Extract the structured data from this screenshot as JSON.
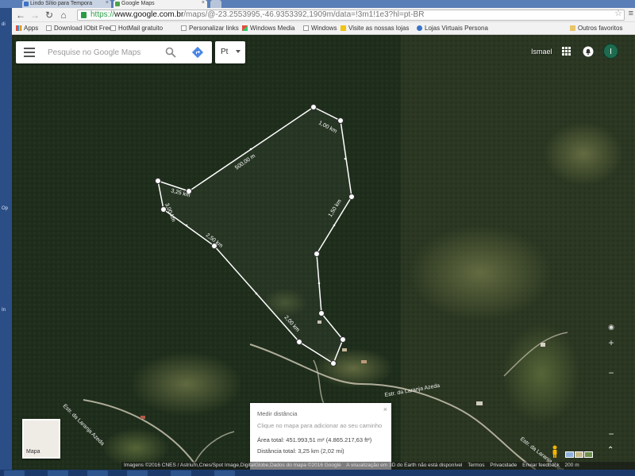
{
  "browser": {
    "tabs": [
      {
        "title": "Lindo Sítio para Tempora",
        "active": false
      },
      {
        "title": "Google Maps",
        "active": true
      }
    ],
    "url": {
      "scheme": "https://",
      "host": "www.google.com.br",
      "path": "/maps/@-23.2553995,-46.9353392,1909m/data=!3m1!1e3?hl=pt-BR"
    },
    "bookmarks": [
      {
        "label": "Apps",
        "icon": "apps-grid-icon"
      },
      {
        "label": "Download IObit Free",
        "icon": "page-icon"
      },
      {
        "label": "HotMail gratuito",
        "icon": "page-icon"
      },
      {
        "label": "Personalizar links",
        "icon": "page-icon"
      },
      {
        "label": "Windows Media",
        "icon": "windows-icon"
      },
      {
        "label": "Windows",
        "icon": "page-icon"
      },
      {
        "label": "Visite as nossas lojas",
        "icon": "store-icon"
      },
      {
        "label": "Lojas Virtuais Persona",
        "icon": "store-icon"
      }
    ],
    "other_bookmarks": "Outros favoritos"
  },
  "maps": {
    "search_placeholder": "Pesquise no Google Maps",
    "language": "Pt",
    "username": "Ismael",
    "avatar_letter": "I",
    "map_type_label": "Mapa",
    "measure": {
      "title": "Medir distância",
      "hint": "Clique no mapa para adicionar ao seu caminho",
      "area": "Área total: 451.993,51 m² (4.865.217,63 ft²)",
      "distance": "Distância total: 3,25 km (2,02 mi)"
    },
    "segment_labels": [
      "500,00 m",
      "1,00 km",
      "1,50 km",
      "2,00 km",
      "2,50 km",
      "3,00 km",
      "3,25 km"
    ],
    "road_labels": [
      "Estr. da Laranja Azeda",
      "Estr. da Laranja Azeda",
      "Estr. da Laranja Azeda"
    ],
    "footer": [
      "Imagens ©2016 CNES / Astrium,Cnes/Spot Image,DigitalGlobe,Dados do mapa ©2016 Google",
      "A visualização em 3D do Earth não está disponível",
      "Termos",
      "Privacidade",
      "Enviar feedback",
      "200 m"
    ]
  }
}
